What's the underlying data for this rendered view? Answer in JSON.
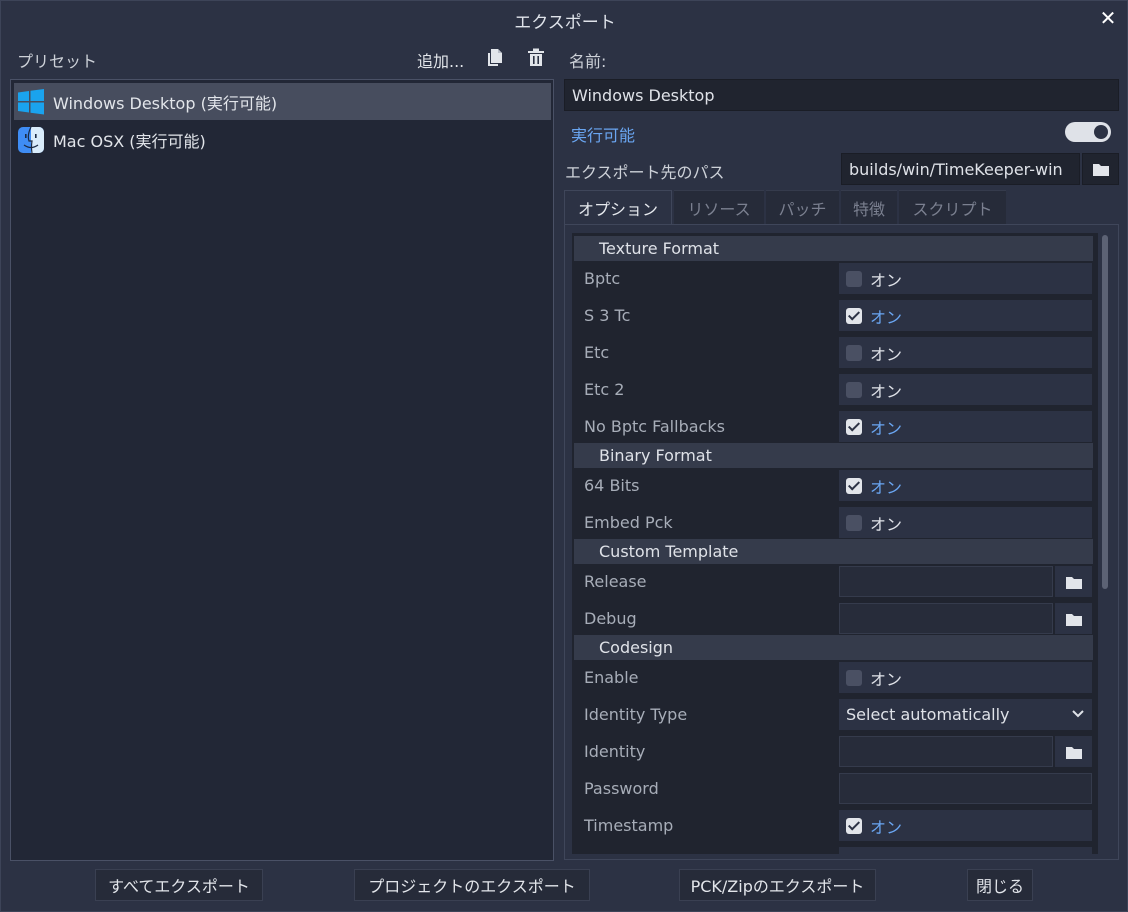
{
  "window": {
    "title": "エクスポート",
    "close_glyph": "✕"
  },
  "left": {
    "presets_label": "プリセット",
    "add_label": "追加...",
    "duplicate_icon": "duplicate-icon",
    "delete_icon": "trash-icon",
    "presets": [
      {
        "label": "Windows Desktop (実行可能)",
        "icon": "windows-logo-icon",
        "selected": true
      },
      {
        "label": "Mac OSX (実行可能)",
        "icon": "macos-finder-icon",
        "selected": false
      }
    ]
  },
  "right": {
    "name_label": "名前:",
    "name_value": "Windows Desktop",
    "runnable_label": "実行可能",
    "runnable_on": true,
    "export_path_label": "エクスポート先のパス",
    "export_path_value": "builds/win/TimeKeeper-win",
    "tabs": [
      "オプション",
      "リソース",
      "パッチ",
      "特徴",
      "スクリプト"
    ],
    "active_tab": "オプション",
    "on_text": "オン",
    "sections": {
      "texture": "Texture Format",
      "binary": "Binary Format",
      "template": "Custom Template",
      "codesign": "Codesign"
    },
    "props": {
      "bptc": {
        "label": "Bptc",
        "checked": false
      },
      "s3tc": {
        "label": "S 3 Tc",
        "checked": true
      },
      "etc": {
        "label": "Etc",
        "checked": false
      },
      "etc2": {
        "label": "Etc 2",
        "checked": false
      },
      "no_bptc": {
        "label": "No Bptc Fallbacks",
        "checked": true
      },
      "bits64": {
        "label": "64 Bits",
        "checked": true
      },
      "embed_pck": {
        "label": "Embed Pck",
        "checked": false
      },
      "release": {
        "label": "Release",
        "value": ""
      },
      "debug": {
        "label": "Debug",
        "value": ""
      },
      "enable": {
        "label": "Enable",
        "checked": false
      },
      "identity_type": {
        "label": "Identity Type",
        "value": "Select automatically"
      },
      "identity": {
        "label": "Identity",
        "value": ""
      },
      "password": {
        "label": "Password",
        "value": ""
      },
      "timestamp": {
        "label": "Timestamp",
        "checked": true
      }
    }
  },
  "buttons": {
    "export_all": "すべてエクスポート",
    "export_project": "プロジェクトのエクスポート",
    "export_pck": "PCK/Zipのエクスポート",
    "close": "閉じる"
  },
  "colors": {
    "panel": "#2c3244",
    "field": "#20242f",
    "accent_blue": "#6aa6f2",
    "selected_row": "#474d5e"
  }
}
